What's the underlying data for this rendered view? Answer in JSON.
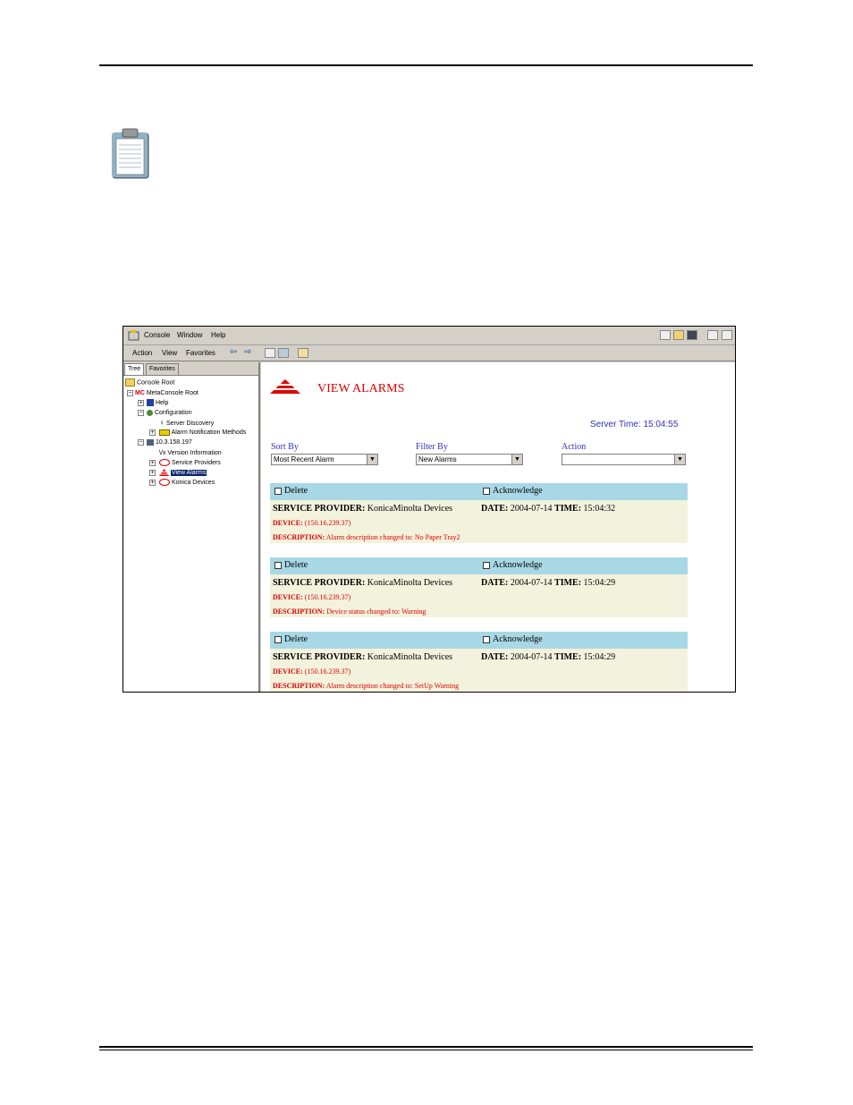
{
  "menu": {
    "console": "Console",
    "window": "Window",
    "help": "Help"
  },
  "toolbar": {
    "action": "Action",
    "view": "View",
    "favorites": "Favorites"
  },
  "tabs": {
    "tree": "Tree",
    "favorites": "Favorites"
  },
  "tree": {
    "console_root": "Console Root",
    "metaconsole_root": "MetaConsole Root",
    "help": "Help",
    "configuration": "Configuration",
    "server_discovery": "Server Discovery",
    "alarm_notification": "Alarm Notification Methods",
    "ip": "10.3.158.197",
    "version_info": "Version Information",
    "service_providers": "Service Providers",
    "view_alarms": "View Alarms",
    "konica_devices": "Konica Devices"
  },
  "page": {
    "title": "VIEW ALARMS",
    "server_time": "Server Time: 15:04:55",
    "sort_by_label": "Sort By",
    "sort_by_value": "Most Recent Alarm",
    "filter_by_label": "Filter By",
    "filter_by_value": "New Alarms",
    "action_label": "Action",
    "action_value": ""
  },
  "labels": {
    "delete": "Delete",
    "acknowledge": "Acknowledge",
    "service_provider": "SERVICE PROVIDER:",
    "date": "DATE:",
    "time": "TIME:",
    "device": "DEVICE:",
    "description": "DESCRIPTION:"
  },
  "alarms": [
    {
      "provider": "KonicaMinolta Devices",
      "date": "2004-07-14",
      "time": "15:04:32",
      "device": "(150.16.239.37)",
      "description": "Alarm description changed to: No Paper Tray2"
    },
    {
      "provider": "KonicaMinolta Devices",
      "date": "2004-07-14",
      "time": "15:04:29",
      "device": "(150.16.239.37)",
      "description": "Device status changed to: Warning"
    },
    {
      "provider": "KonicaMinolta Devices",
      "date": "2004-07-14",
      "time": "15:04:29",
      "device": "(150.16.239.37)",
      "description": "Alarm description changed to: SetUp Warning"
    }
  ],
  "icons": [
    "clipboard-icon",
    "console-icon",
    "new-icon",
    "open-icon",
    "save-icon",
    "back-icon",
    "forward-icon",
    "folder-icon",
    "view-alarms-icon"
  ]
}
